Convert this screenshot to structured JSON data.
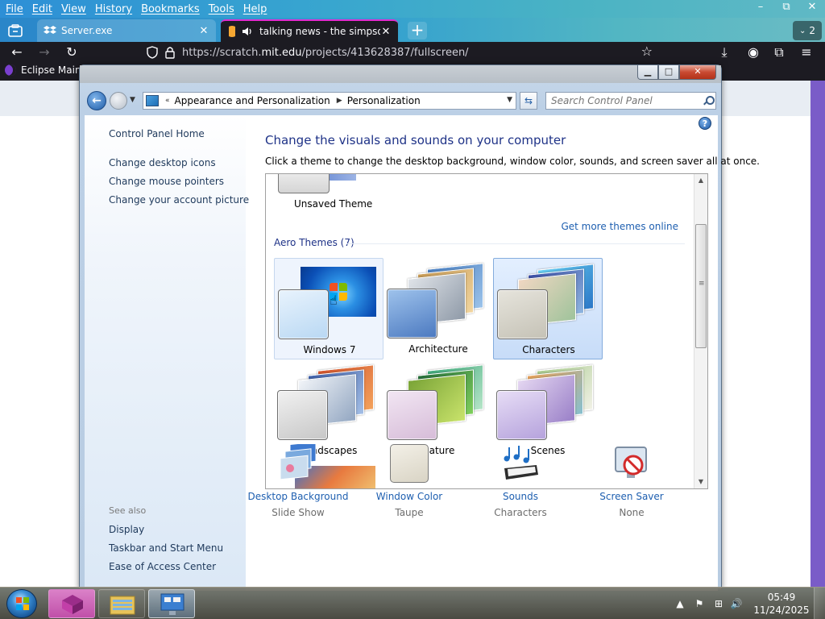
{
  "browser": {
    "menus": [
      "File",
      "Edit",
      "View",
      "History",
      "Bookmarks",
      "Tools",
      "Help"
    ],
    "window_controls": {
      "minimize": "–",
      "restore": "⧉",
      "close": "✕"
    },
    "tabs": [
      {
        "title": "Server.exe",
        "active": false
      },
      {
        "title": "talking news - the simpsons",
        "active": true
      }
    ],
    "new_tab_label": "+",
    "all_tabs_count": "2",
    "url": {
      "prefix": "https://scratch.",
      "domain": "mit.edu",
      "path": "/projects/413628387/fullscreen/"
    },
    "bookmarks": [
      {
        "label": "Eclipse Main"
      }
    ]
  },
  "control_panel": {
    "address": {
      "crumbs": [
        "Appearance and Personalization",
        "Personalization"
      ],
      "search_placeholder": "Search Control Panel"
    },
    "sidebar": {
      "home_link": "Control Panel Home",
      "links": [
        "Change desktop icons",
        "Change mouse pointers",
        "Change your account picture"
      ],
      "see_also_label": "See also",
      "see_also_links": [
        "Display",
        "Taskbar and Start Menu",
        "Ease of Access Center"
      ]
    },
    "heading": "Change the visuals and sounds on your computer",
    "subheading": "Click a theme to change the desktop background, window color, sounds, and screen saver all at once.",
    "unsaved_theme_label": "Unsaved Theme",
    "more_themes_link": "Get more themes online",
    "aero_header": "Aero Themes (7)",
    "themes": [
      {
        "name": "Windows 7",
        "state": "hover"
      },
      {
        "name": "Architecture",
        "state": "normal"
      },
      {
        "name": "Characters",
        "state": "selected"
      },
      {
        "name": "Landscapes",
        "state": "normal"
      },
      {
        "name": "Nature",
        "state": "normal"
      },
      {
        "name": "Scenes",
        "state": "normal"
      }
    ],
    "customize": [
      {
        "label": "Desktop Background",
        "value": "Slide Show",
        "icon": "desktop-background-icon"
      },
      {
        "label": "Window Color",
        "value": "Taupe",
        "icon": "window-color-icon"
      },
      {
        "label": "Sounds",
        "value": "Characters",
        "icon": "sounds-icon"
      },
      {
        "label": "Screen Saver",
        "value": "None",
        "icon": "screen-saver-icon"
      }
    ],
    "help_label": "?"
  },
  "taskbar": {
    "clock_time": "05:49",
    "clock_date": "11/24/2025"
  }
}
